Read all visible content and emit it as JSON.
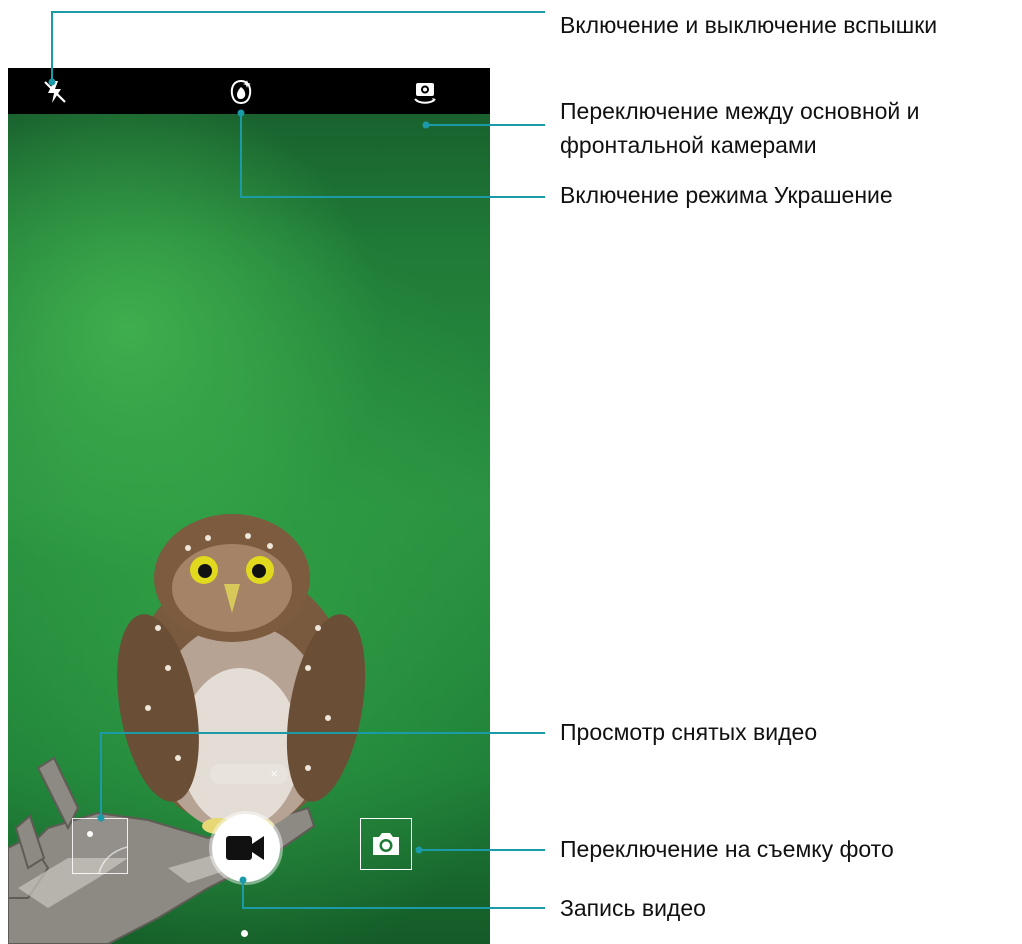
{
  "callouts": {
    "flash": "Включение и выключение вспышки",
    "switch_camera_line1": "Переключение между основной и",
    "switch_camera_line2": "фронтальной камерами",
    "beauty": "Включение режима Украшение",
    "view_videos": "Просмотр снятых видео",
    "switch_photo": "Переключение на съемку фото",
    "record": "Запись видео"
  },
  "camera_ui": {
    "icons": {
      "flash": "flash-off-icon",
      "beauty": "beauty-mode-icon",
      "switch_camera": "switch-camera-icon",
      "record": "video-record-icon",
      "photo": "photo-camera-icon",
      "close": "close-icon"
    },
    "pill_close": "×"
  },
  "colors": {
    "callout_line": "#1b9aa8",
    "topbar": "#000000",
    "background_green": "#2a9141"
  }
}
